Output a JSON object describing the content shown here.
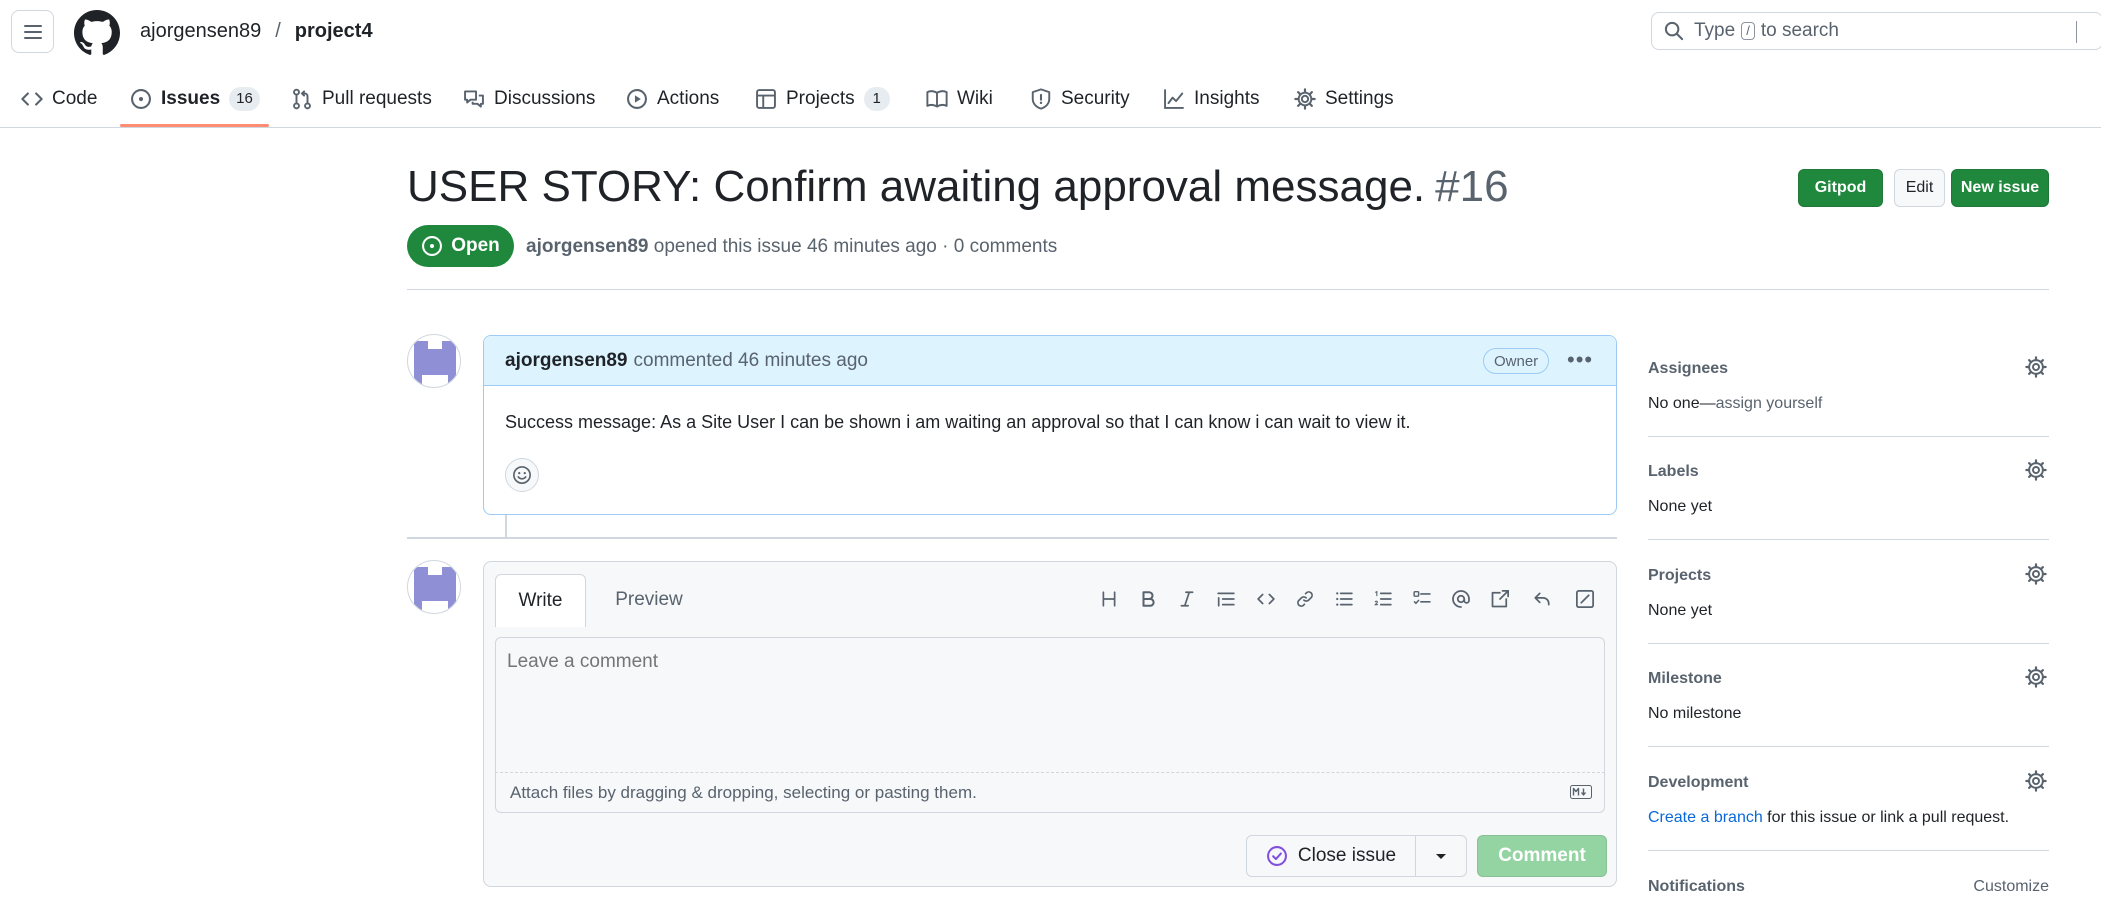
{
  "header": {
    "owner": "ajorgensen89",
    "separator": "/",
    "repo": "project4",
    "search_prefix": "Type",
    "search_key": "/",
    "search_suffix": "to search"
  },
  "nav": {
    "code": "Code",
    "issues": "Issues",
    "issues_count": "16",
    "pull_requests": "Pull requests",
    "discussions": "Discussions",
    "actions": "Actions",
    "projects": "Projects",
    "projects_count": "1",
    "wiki": "Wiki",
    "security": "Security",
    "insights": "Insights",
    "settings": "Settings"
  },
  "issue": {
    "title": "USER STORY: Confirm awaiting approval message.",
    "number": "#16",
    "state": "Open",
    "author": "ajorgensen89",
    "meta": "opened this issue 46 minutes ago · 0 comments",
    "buttons": {
      "gitpod": "Gitpod",
      "edit": "Edit",
      "new_issue": "New issue"
    }
  },
  "comment": {
    "author": "ajorgensen89",
    "action": "commented 46 minutes ago",
    "badge": "Owner",
    "body": "Success message: As a Site User I can be shown i am waiting an approval so that I can know i can wait to view it."
  },
  "form": {
    "tab_write": "Write",
    "tab_preview": "Preview",
    "placeholder": "Leave a comment",
    "attach_text": "Attach files by dragging & dropping, selecting or pasting them.",
    "close_issue": "Close issue",
    "comment": "Comment"
  },
  "sidebar": {
    "assignees": {
      "title": "Assignees",
      "value_prefix": "No one—",
      "value_link": "assign yourself"
    },
    "labels": {
      "title": "Labels",
      "value": "None yet"
    },
    "projects": {
      "title": "Projects",
      "value": "None yet"
    },
    "milestone": {
      "title": "Milestone",
      "value": "No milestone"
    },
    "development": {
      "title": "Development",
      "link": "Create a branch",
      "rest": " for this issue or link a pull request."
    },
    "notifications": {
      "title": "Notifications",
      "action": "Customize"
    }
  },
  "colors": {
    "accent_green": "#1f883d",
    "comment_header_bg": "#ddf4ff",
    "link_blue": "#0969da",
    "active_tab_underline": "#fd8c73"
  }
}
